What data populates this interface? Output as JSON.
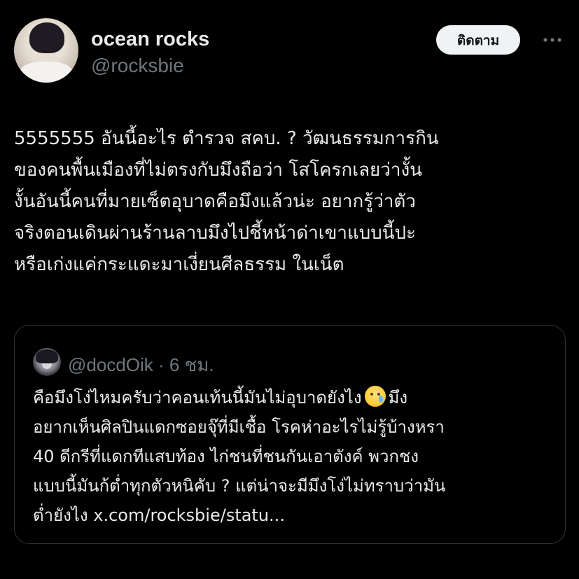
{
  "author": {
    "display_name": "ocean rocks",
    "handle": "@rocksbie",
    "avatar_icon": "profile-photo"
  },
  "actions": {
    "follow_label": "ติดตาม",
    "more_icon": "more-horizontal-icon"
  },
  "post": {
    "lines": [
      "5555555 อันนี้อะไร ตำรวจ สคบ. ? วัฒนธรรมการกิน",
      "ของคนพื้นเมืองที่ไม่ตรงกับมึงถือว่า โสโครกเลยว่างั้น",
      "งั้นอันนี้คนที่มายเซ็ตอุบาดคือมึงแล้วน่ะ อยากรู้ว่าตัว",
      "จริงตอนเดินผ่านร้านลาบมึงไปชี้หน้าด่าเขาแบบนี้ปะ",
      "หรือเก่งแค่กระแดะมาเงี่ยนศีลธรรม ในเน็ต"
    ]
  },
  "quote": {
    "handle": "@docdOik",
    "time": " · 6 ชม.",
    "avatar_icon": "anime-avatar",
    "emoji_icon": "crying-face-emoji",
    "line1_before": "คือมึงโง่ไหมครับว่าคอนเท้นนี้มันไม่อุบาดยังไง",
    "line1_after": "มึง",
    "lines": [
      "อยากเห็นศิลปินแดกซอยจุ๊ที่มีเชื้อ โรคห่าอะไรไม่รู้บ้างหรา",
      "40 ดีกรีที่แดกทีแสบท้อง ไก่ชนที่ชนกันเอาตังค์ พวกชง",
      "แบบนี้มันก้ต่ำทุกตัวหนิคับ ? แต่น่าจะมีมึงโง่ไม่ทราบว่ามัน",
      "ต่ำยังไง x.com/rocksbie/statu..."
    ]
  },
  "colors": {
    "background": "#000000",
    "text": "#e7e9ea",
    "secondary_text": "#71767b",
    "border": "#2f3336",
    "button_bg": "#eff3f4",
    "button_text": "#0f1419"
  }
}
